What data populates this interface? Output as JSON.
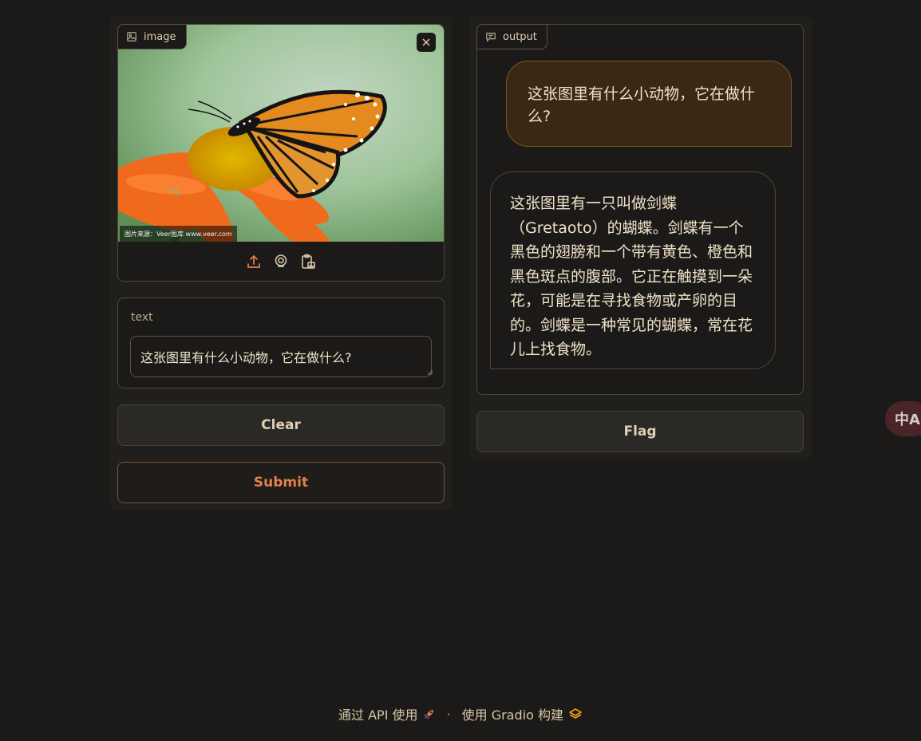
{
  "image_panel": {
    "label": "image",
    "watermark": "图片来源：Veer图库 www.veer.com",
    "toolbar": {
      "upload_icon": "upload-icon",
      "webcam_icon": "webcam-icon",
      "clipboard_icon": "clipboard-icon"
    }
  },
  "text_panel": {
    "label": "text",
    "value": "这张图里有什么小动物，它在做什么?"
  },
  "buttons": {
    "clear": "Clear",
    "submit": "Submit",
    "flag": "Flag"
  },
  "output_panel": {
    "label": "output",
    "user_message": "这张图里有什么小动物，它在做什么?",
    "bot_message": "这张图里有一只叫做剑蝶（Gretaoto）的蝴蝶。剑蝶有一个黑色的翅膀和一个带有黄色、橙色和黑色斑点的腹部。它正在触摸到一朵花，可能是在寻找食物或产卵的目的。剑蝶是一种常见的蝴蝶，常在花儿上找食物。"
  },
  "translate_fab": {
    "label": "中A"
  },
  "footer": {
    "api_link": "通过 API 使用",
    "separator": "·",
    "built_with": "使用 Gradio 构建"
  },
  "colors": {
    "background": "#1c1a18",
    "accent": "#e0814a",
    "user_bubble": "#3a2814"
  }
}
